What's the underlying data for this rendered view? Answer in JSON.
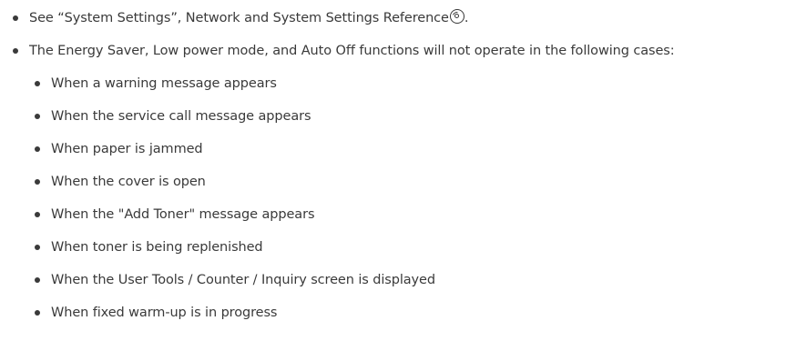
{
  "notes": {
    "item1_text": "See “System Settings”, Network and System Settings Reference",
    "item1_icon": "disc-icon",
    "item1_suffix": ".",
    "item2_text": "The Energy Saver, Low power mode, and Auto Off functions will not operate in the following cases:",
    "cases": [
      "When a warning message appears",
      "When the service call message appears",
      "When paper is jammed",
      "When the cover is open",
      "When the \"Add Toner\" message appears",
      "When toner is being replenished",
      "When the User Tools / Counter / Inquiry screen is displayed",
      "When fixed warm-up is in progress"
    ]
  }
}
